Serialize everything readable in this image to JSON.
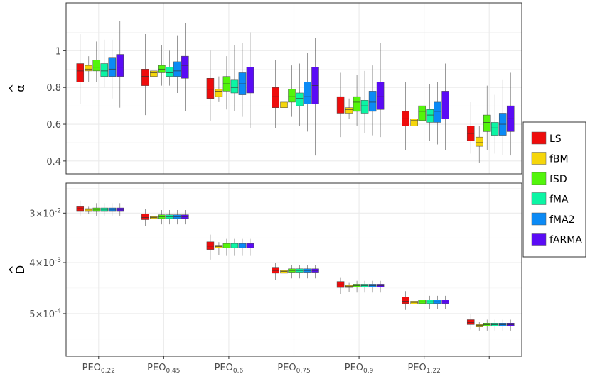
{
  "chart_data": {
    "type": "box",
    "categories": [
      "PEO",
      "PEO",
      "PEO",
      "PEO",
      "PEO",
      "PEO",
      ""
    ],
    "category_subscripts": [
      "0.22",
      "0.45",
      "0.6",
      "0.75",
      "0.9",
      "1.22",
      ""
    ],
    "series_names": [
      "LS",
      "fBM",
      "fSD",
      "fMA",
      "fMA2",
      "fARMA"
    ],
    "series_colors": [
      "#ee0c0c",
      "#f5d60b",
      "#53f50b",
      "#0bf5a4",
      "#0b8af5",
      "#5a0bf5"
    ],
    "legend_placement": "right",
    "grid": true,
    "panels": [
      {
        "ylabel": "α",
        "ylabel_hat": "^",
        "scale": "linear",
        "ylim": [
          0.33,
          1.26
        ],
        "yticks": [
          0.4,
          0.6,
          0.8,
          1.0
        ],
        "ytick_labels": [
          "0.4",
          "0.6",
          "0.8",
          "1"
        ],
        "boxes": [
          [
            [
              0.71,
              0.83,
              0.89,
              0.93,
              1.09
            ],
            [
              0.83,
              0.89,
              0.9,
              0.92,
              0.97
            ],
            [
              0.83,
              0.89,
              0.91,
              0.95,
              1.05
            ],
            [
              0.8,
              0.86,
              0.89,
              0.93,
              1.06
            ],
            [
              0.74,
              0.86,
              0.9,
              0.96,
              1.06
            ],
            [
              0.69,
              0.86,
              0.91,
              0.98,
              1.16
            ]
          ],
          [
            [
              0.65,
              0.81,
              0.86,
              0.9,
              1.09
            ],
            [
              0.82,
              0.86,
              0.88,
              0.89,
              0.95
            ],
            [
              0.81,
              0.88,
              0.9,
              0.92,
              1.03
            ],
            [
              0.81,
              0.86,
              0.88,
              0.91,
              1.0
            ],
            [
              0.77,
              0.86,
              0.89,
              0.94,
              1.08
            ],
            [
              0.67,
              0.85,
              0.92,
              0.97,
              1.15
            ]
          ],
          [
            [
              0.62,
              0.74,
              0.79,
              0.85,
              1.0
            ],
            [
              0.72,
              0.75,
              0.78,
              0.79,
              0.86
            ],
            [
              0.68,
              0.78,
              0.82,
              0.86,
              0.97
            ],
            [
              0.67,
              0.77,
              0.8,
              0.84,
              1.03
            ],
            [
              0.64,
              0.76,
              0.82,
              0.88,
              1.04
            ],
            [
              0.58,
              0.77,
              0.83,
              0.91,
              1.1
            ]
          ],
          [
            [
              0.58,
              0.69,
              0.75,
              0.8,
              0.95
            ],
            [
              0.67,
              0.69,
              0.71,
              0.72,
              0.78
            ],
            [
              0.64,
              0.72,
              0.75,
              0.79,
              0.92
            ],
            [
              0.59,
              0.7,
              0.74,
              0.77,
              0.93
            ],
            [
              0.56,
              0.71,
              0.75,
              0.83,
              0.99
            ],
            [
              0.43,
              0.71,
              0.81,
              0.91,
              1.07
            ]
          ],
          [
            [
              0.53,
              0.66,
              0.71,
              0.75,
              0.88
            ],
            [
              0.63,
              0.66,
              0.68,
              0.69,
              0.74
            ],
            [
              0.59,
              0.67,
              0.72,
              0.75,
              0.87
            ],
            [
              0.55,
              0.66,
              0.7,
              0.73,
              0.89
            ],
            [
              0.54,
              0.67,
              0.72,
              0.78,
              0.92
            ],
            [
              0.53,
              0.68,
              0.75,
              0.83,
              1.04
            ]
          ],
          [
            [
              0.46,
              0.59,
              0.63,
              0.67,
              0.83
            ],
            [
              0.57,
              0.59,
              0.62,
              0.63,
              0.69
            ],
            [
              0.54,
              0.62,
              0.67,
              0.7,
              0.84
            ],
            [
              0.51,
              0.61,
              0.65,
              0.68,
              0.82
            ],
            [
              0.49,
              0.61,
              0.67,
              0.72,
              0.83
            ],
            [
              0.46,
              0.63,
              0.71,
              0.78,
              0.93
            ]
          ],
          [
            [
              0.44,
              0.51,
              0.55,
              0.59,
              0.72
            ],
            [
              0.39,
              0.48,
              0.5,
              0.53,
              0.59
            ],
            [
              0.46,
              0.56,
              0.61,
              0.65,
              0.81
            ],
            [
              0.44,
              0.54,
              0.58,
              0.61,
              0.76
            ],
            [
              0.43,
              0.54,
              0.6,
              0.66,
              0.84
            ],
            [
              0.43,
              0.56,
              0.63,
              0.7,
              0.88
            ]
          ]
        ]
      },
      {
        "ylabel": "D",
        "ylabel_hat": "^",
        "scale": "log10",
        "ylim": [
          8.8e-05,
          0.102
        ],
        "yticks": [
          0.03,
          0.004,
          0.0005
        ],
        "ytick_labels": [
          {
            "mantissa": "3",
            "exponent": "-2"
          },
          {
            "mantissa": "4",
            "exponent": "-3"
          },
          {
            "mantissa": "5",
            "exponent": "-4"
          }
        ],
        "times_symbol": "×",
        "base": "10",
        "boxes": [
          [
            [
              0.027,
              0.033,
              0.036,
              0.04,
              0.05
            ],
            [
              0.029,
              0.033,
              0.035,
              0.036,
              0.04
            ],
            [
              0.027,
              0.033,
              0.035,
              0.037,
              0.045
            ],
            [
              0.027,
              0.033,
              0.035,
              0.037,
              0.045
            ],
            [
              0.027,
              0.033,
              0.035,
              0.037,
              0.045
            ],
            [
              0.027,
              0.033,
              0.035,
              0.037,
              0.045
            ]
          ],
          [
            [
              0.018,
              0.023,
              0.025,
              0.029,
              0.035
            ],
            [
              0.019,
              0.024,
              0.025,
              0.026,
              0.031
            ],
            [
              0.019,
              0.024,
              0.026,
              0.028,
              0.034
            ],
            [
              0.019,
              0.024,
              0.026,
              0.028,
              0.034
            ],
            [
              0.019,
              0.024,
              0.026,
              0.028,
              0.034
            ],
            [
              0.019,
              0.024,
              0.026,
              0.028,
              0.034
            ]
          ],
          [
            [
              0.0045,
              0.0068,
              0.0078,
              0.0093,
              0.0125
            ],
            [
              0.0055,
              0.0072,
              0.0077,
              0.0081,
              0.0092
            ],
            [
              0.0054,
              0.0073,
              0.0079,
              0.0087,
              0.0105
            ],
            [
              0.0054,
              0.0073,
              0.0079,
              0.0087,
              0.0105
            ],
            [
              0.0054,
              0.0073,
              0.0079,
              0.0087,
              0.0105
            ],
            [
              0.0054,
              0.0073,
              0.0079,
              0.0087,
              0.0105
            ]
          ],
          [
            [
              0.002,
              0.0026,
              0.0029,
              0.0033,
              0.004
            ],
            [
              0.0022,
              0.0026,
              0.0028,
              0.0029,
              0.0033
            ],
            [
              0.0021,
              0.0027,
              0.0029,
              0.0031,
              0.0036
            ],
            [
              0.0021,
              0.0027,
              0.0029,
              0.0031,
              0.0036
            ],
            [
              0.0021,
              0.0027,
              0.0029,
              0.0031,
              0.0036
            ],
            [
              0.0021,
              0.0027,
              0.0029,
              0.0031,
              0.0036
            ]
          ],
          [
            [
              0.00112,
              0.00145,
              0.00162,
              0.00185,
              0.0022
            ],
            [
              0.00122,
              0.00145,
              0.00152,
              0.00158,
              0.00175
            ],
            [
              0.00118,
              0.00147,
              0.00156,
              0.00166,
              0.0019
            ],
            [
              0.00118,
              0.00147,
              0.00156,
              0.00166,
              0.0019
            ],
            [
              0.00118,
              0.00147,
              0.00156,
              0.00166,
              0.0019
            ],
            [
              0.00118,
              0.00147,
              0.00156,
              0.00166,
              0.0019
            ]
          ],
          [
            [
              0.00058,
              0.00075,
              0.00083,
              0.00098,
              0.00125
            ],
            [
              0.00063,
              0.00074,
              0.00079,
              0.00083,
              0.00094
            ],
            [
              0.00061,
              0.00075,
              0.00081,
              0.00087,
              0.00103
            ],
            [
              0.00061,
              0.00075,
              0.00081,
              0.00087,
              0.00103
            ],
            [
              0.00061,
              0.00075,
              0.00081,
              0.00087,
              0.00103
            ],
            [
              0.00061,
              0.00075,
              0.00081,
              0.00087,
              0.00103
            ]
          ],
          [
            [
              0.00026,
              0.00032,
              0.00035,
              0.00039,
              0.00049
            ],
            [
              0.00025,
              0.00029,
              0.00031,
              0.00032,
              0.00036
            ],
            [
              0.00025,
              0.0003,
              0.00032,
              0.00034,
              0.00039
            ],
            [
              0.00025,
              0.0003,
              0.00032,
              0.00034,
              0.00039
            ],
            [
              0.00025,
              0.0003,
              0.00032,
              0.00034,
              0.00039
            ],
            [
              0.00025,
              0.0003,
              0.00032,
              0.00034,
              0.00039
            ]
          ]
        ]
      }
    ]
  }
}
